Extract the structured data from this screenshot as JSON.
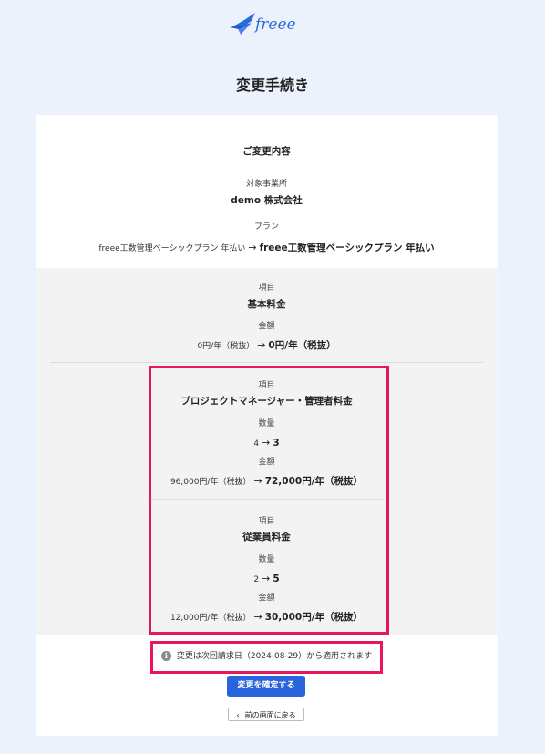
{
  "logo": {
    "text": "freee"
  },
  "page_title": "変更手続き",
  "summary": {
    "heading": "ご変更内容",
    "office_label": "対象事業所",
    "office_value": "demo 株式会社",
    "plan_label": "プラン",
    "plan_old": "freee工数管理ベーシックプラン 年払い",
    "arrow": "→",
    "plan_new": "freee工数管理ベーシックプラン 年払い"
  },
  "items": [
    {
      "item_label": "項目",
      "item_value": "基本料金",
      "amount_label": "金額",
      "amount_old": "0円/年（税抜）",
      "amount_new": "0円/年（税抜）"
    },
    {
      "item_label": "項目",
      "item_value": "プロジェクトマネージャー・管理者料金",
      "qty_label": "数量",
      "qty_old": "4",
      "qty_new": "3",
      "amount_label": "金額",
      "amount_old": "96,000円/年（税抜）",
      "amount_new": "72,000円/年（税抜）"
    },
    {
      "item_label": "項目",
      "item_value": "従業員料金",
      "qty_label": "数量",
      "qty_old": "2",
      "qty_new": "5",
      "amount_label": "金額",
      "amount_old": "12,000円/年（税抜）",
      "amount_new": "30,000円/年（税抜）"
    }
  ],
  "notice": "変更は次回請求日（2024-08-29）から適用されます",
  "buttons": {
    "confirm": "変更を確定する",
    "back": "前の画面に戻る"
  },
  "colors": {
    "primary": "#2864dc",
    "highlight": "#e8175d",
    "background": "#ecf2fb",
    "logo": "#2b6be0"
  }
}
